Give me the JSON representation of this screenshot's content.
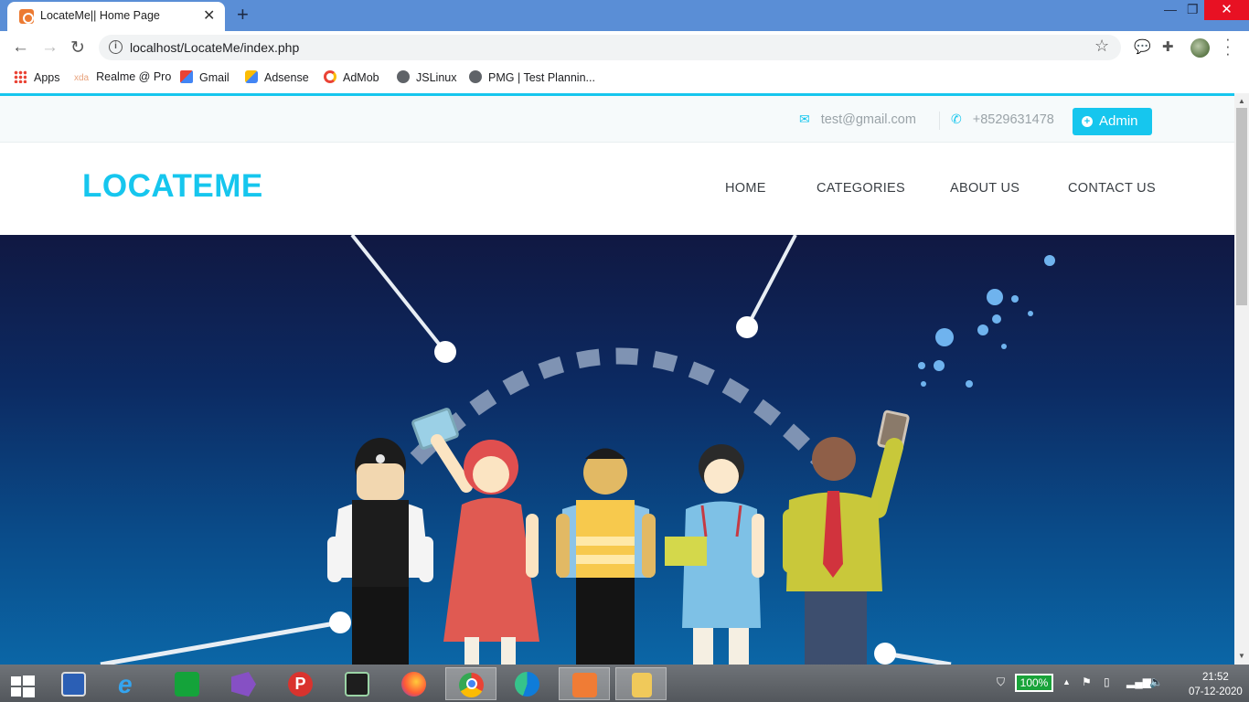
{
  "browser": {
    "tab_title": "LocateMe|| Home Page",
    "url": "localhost/LocateMe/index.php",
    "bookmarks": [
      {
        "label": "Apps",
        "icon": "apps-grid-icon"
      },
      {
        "label": "Realme @ Pro",
        "icon": "xda-icon",
        "prefix": "xda"
      },
      {
        "label": "Gmail",
        "icon": "gmail-icon"
      },
      {
        "label": "Adsense",
        "icon": "adsense-icon"
      },
      {
        "label": "AdMob",
        "icon": "admob-icon"
      },
      {
        "label": "JSLinux",
        "icon": "globe-icon"
      },
      {
        "label": "PMG | Test Plannin...",
        "icon": "globe-icon"
      }
    ]
  },
  "site": {
    "email": "test@gmail.com",
    "phone": "+8529631478",
    "admin_label": "Admin",
    "logo": "LOCATEME",
    "nav": [
      "HOME",
      "CATEGORIES",
      "ABOUT US",
      "CONTACT US"
    ],
    "accent_color": "#16c6ee"
  },
  "taskbar": {
    "apps": [
      "start-icon",
      "lenovo-icon",
      "internet-explorer-icon",
      "store-icon",
      "visual-studio-icon",
      "psiphon-icon",
      "terminal-icon",
      "firefox-icon",
      "chrome-icon",
      "edge-icon",
      "xampp-icon",
      "file-explorer-icon"
    ],
    "active_app": "chrome-icon",
    "battery": "100%",
    "time": "21:52",
    "date": "07-12-2020"
  }
}
